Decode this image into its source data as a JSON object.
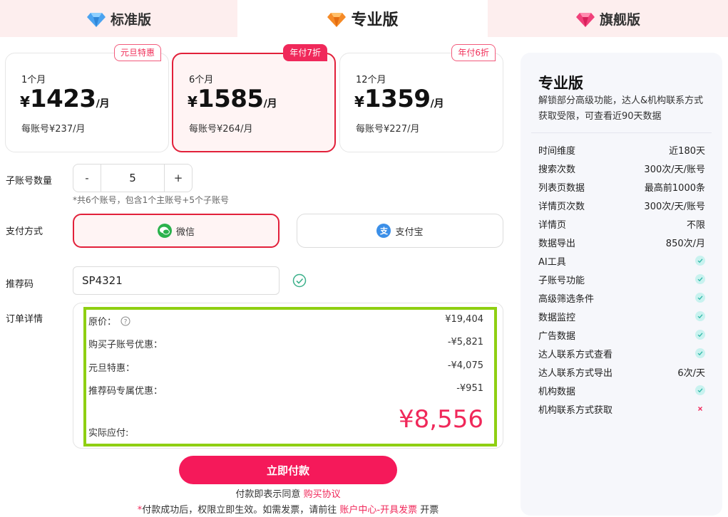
{
  "tabs": [
    {
      "label": "标准版",
      "icon": "blue-diamond-icon",
      "color": "#4aa3f0"
    },
    {
      "label": "专业版",
      "icon": "orange-diamond-icon",
      "color": "#f58a26"
    },
    {
      "label": "旗舰版",
      "icon": "pink-diamond-icon",
      "color": "#f0407a"
    }
  ],
  "plans": [
    {
      "badge": "元旦特惠",
      "duration": "1个月",
      "yen": "¥",
      "price": "1423",
      "unit": "/月",
      "per_account": "每账号¥237/月",
      "selected": false
    },
    {
      "badge": "年付7折",
      "duration": "6个月",
      "yen": "¥",
      "price": "1585",
      "unit": "/月",
      "per_account": "每账号¥264/月",
      "selected": true
    },
    {
      "badge": "年付6折",
      "duration": "12个月",
      "yen": "¥",
      "price": "1359",
      "unit": "/月",
      "per_account": "每账号¥227/月",
      "selected": false
    }
  ],
  "sub_accounts": {
    "label": "子账号数量",
    "minus": "-",
    "value": "5",
    "plus": "+",
    "note": "*共6个账号，包含1个主账号+5个子账号"
  },
  "payment": {
    "label": "支付方式",
    "wechat": "微信",
    "alipay": "支付宝",
    "alipay_glyph": "支"
  },
  "referral": {
    "label": "推荐码",
    "value": "SP4321"
  },
  "order": {
    "label": "订单详情",
    "rows": [
      {
        "label": "原价：",
        "value": "¥19,404"
      },
      {
        "label": "购买子账号优惠：",
        "value": "-¥5,821"
      },
      {
        "label": "元旦特惠：",
        "value": "-¥4,075"
      },
      {
        "label": "推荐码专属优惠：",
        "value": "-¥951"
      }
    ],
    "total_label": "实际应付:",
    "total": "¥8,556"
  },
  "pay_now": "立即付款",
  "agreement": {
    "text": "付款即表示同意",
    "link": "购买协议"
  },
  "notice": {
    "star": "*",
    "text": "付款成功后，权限立即生效。如需发票，请前往",
    "link": "账户中心-开具发票",
    "tail": "开票"
  },
  "side": {
    "title": "专业版",
    "desc": "解锁部分高级功能，达人&机构联系方式获取受限，可查看近90天数据",
    "features": [
      {
        "name": "时间维度",
        "value": "近180天"
      },
      {
        "name": "搜索次数",
        "value": "300次/天/账号"
      },
      {
        "name": "列表页数据",
        "value": "最高前1000条"
      },
      {
        "name": "详情页次数",
        "value": "300次/天/账号"
      },
      {
        "name": "详情页",
        "value": "不限"
      },
      {
        "name": "数据导出",
        "value": "850次/月"
      },
      {
        "name": "AI工具",
        "value": "check"
      },
      {
        "name": "子账号功能",
        "value": "check"
      },
      {
        "name": "高级筛选条件",
        "value": "check"
      },
      {
        "name": "数据监控",
        "value": "check"
      },
      {
        "name": "广告数据",
        "value": "check"
      },
      {
        "name": "达人联系方式查看",
        "value": "check"
      },
      {
        "name": "达人联系方式导出",
        "value": "6次/天"
      },
      {
        "name": "机构数据",
        "value": "check"
      },
      {
        "name": "机构联系方式获取",
        "value": "cross"
      }
    ]
  },
  "colors": {
    "accent": "#f0285a",
    "selected_border": "#e2203a",
    "highlight_border": "#8fcf12",
    "wechat": "#2bb24c",
    "alipay": "#3b8fe8"
  }
}
